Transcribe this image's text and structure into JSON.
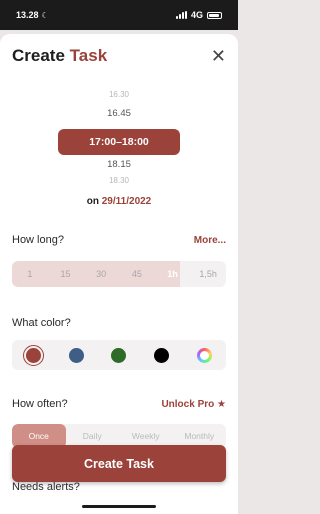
{
  "status_bar": {
    "time": "13.28",
    "network": "4G"
  },
  "header": {
    "title_plain": "Create",
    "title_accent": "Task",
    "close_glyph": "✕"
  },
  "time_picker": {
    "items_above": [
      "16.30",
      "16.45"
    ],
    "selected": "17:00–18:00",
    "items_below": [
      "18.15",
      "18.30"
    ]
  },
  "date": {
    "prefix": "on",
    "value": "29/11/2022"
  },
  "how_long": {
    "label": "How long?",
    "link": "More...",
    "options": [
      "1",
      "15",
      "30",
      "45",
      "1h",
      "1,5h"
    ],
    "selected_index": 4
  },
  "what_color": {
    "label": "What color?",
    "swatches": [
      {
        "name": "red",
        "color": "#9b423a",
        "selected": true
      },
      {
        "name": "blue",
        "color": "#3e5d87",
        "selected": false
      },
      {
        "name": "green",
        "color": "#2e6a28",
        "selected": false
      },
      {
        "name": "black",
        "color": "#000000",
        "selected": false
      },
      {
        "name": "custom",
        "color": "rainbow",
        "selected": false
      }
    ]
  },
  "how_often": {
    "label": "How often?",
    "link": "Unlock Pro",
    "link_icon": "★",
    "options": [
      "Once",
      "Daily",
      "Weekly",
      "Monthly"
    ],
    "selected_index": 0
  },
  "create_button": {
    "label": "Create Task"
  },
  "alerts": {
    "label": "Needs alerts?"
  },
  "colors": {
    "accent": "#9b423a",
    "accent_light": "#ecd9d7"
  }
}
